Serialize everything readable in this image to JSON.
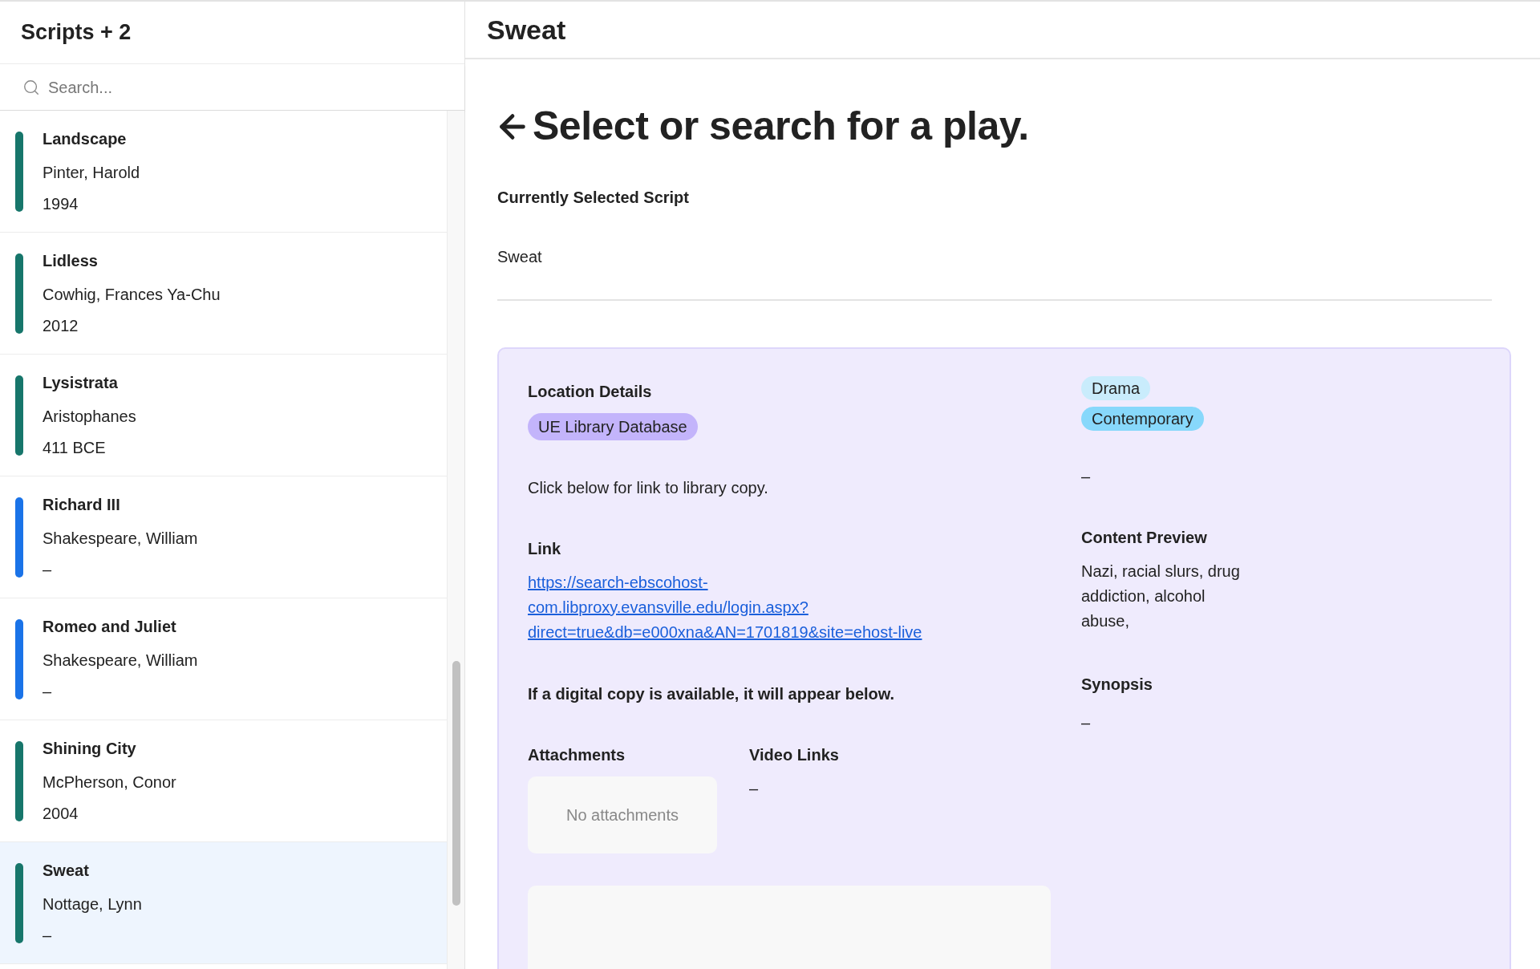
{
  "sidebar": {
    "title": "Scripts + 2",
    "search": {
      "placeholder": "Search..."
    },
    "items": [
      {
        "title": "Landscape",
        "author": "Pinter, Harold",
        "year": "1994",
        "color": "#17766b",
        "selected": false
      },
      {
        "title": "Lidless",
        "author": "Cowhig, Frances Ya-Chu",
        "year": "2012",
        "color": "#17766b",
        "selected": false
      },
      {
        "title": "Lysistrata",
        "author": "Aristophanes",
        "year": "411 BCE",
        "color": "#17766b",
        "selected": false
      },
      {
        "title": "Richard III",
        "author": "Shakespeare, William",
        "year": "–",
        "color": "#1a73e8",
        "selected": false
      },
      {
        "title": "Romeo and Juliet",
        "author": "Shakespeare, William",
        "year": "–",
        "color": "#1a73e8",
        "selected": false
      },
      {
        "title": "Shining City",
        "author": "McPherson, Conor",
        "year": "2004",
        "color": "#17766b",
        "selected": false
      },
      {
        "title": "Sweat",
        "author": "Nottage, Lynn",
        "year": "–",
        "color": "#17766b",
        "selected": true
      }
    ]
  },
  "main": {
    "header": "Sweat",
    "heading": "Select or search for a play.",
    "selected_label": "Currently Selected Script",
    "selected_value": "Sweat",
    "details": {
      "location_label": "Location Details",
      "location_tag": "UE Library Database",
      "click_note": "Click below for link to library copy.",
      "link_label": "Link",
      "link": "https://search-ebscohost-com.libproxy.evansville.edu/login.aspx?direct=true&db=e000xna&AN=1701819&site=ehost-live",
      "digital_note": "If a digital copy is available, it will appear below.",
      "attachments_label": "Attachments",
      "attachments_empty": "No attachments",
      "video_label": "Video Links",
      "video_value": "–",
      "tags": [
        {
          "label": "Drama",
          "color": "#c9ecfc"
        },
        {
          "label": "Contemporary",
          "color": "#87d8fb"
        }
      ],
      "tags_note": "–",
      "content_label": "Content Preview",
      "content_value": "Nazi, racial slurs, drug addiction, alcohol abuse,",
      "synopsis_label": "Synopsis",
      "synopsis_value": "–"
    }
  }
}
